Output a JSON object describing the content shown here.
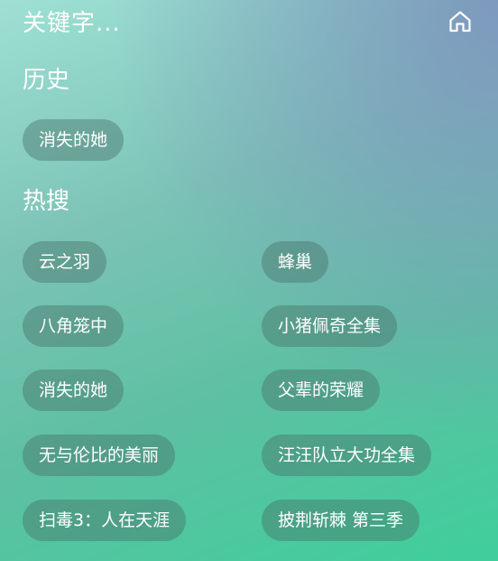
{
  "search": {
    "text": "关键字..."
  },
  "home_icon": "home-icon",
  "history": {
    "title": "历史",
    "items": [
      "消失的她"
    ]
  },
  "hot": {
    "title": "热搜",
    "items": [
      "云之羽",
      "蜂巢",
      "八角笼中",
      "小猪佩奇全集",
      "消失的她",
      "父辈的荣耀",
      "无与伦比的美丽",
      "汪汪队立大功全集",
      "扫毒3：人在天涯",
      "披荆斩棘 第三季"
    ]
  }
}
